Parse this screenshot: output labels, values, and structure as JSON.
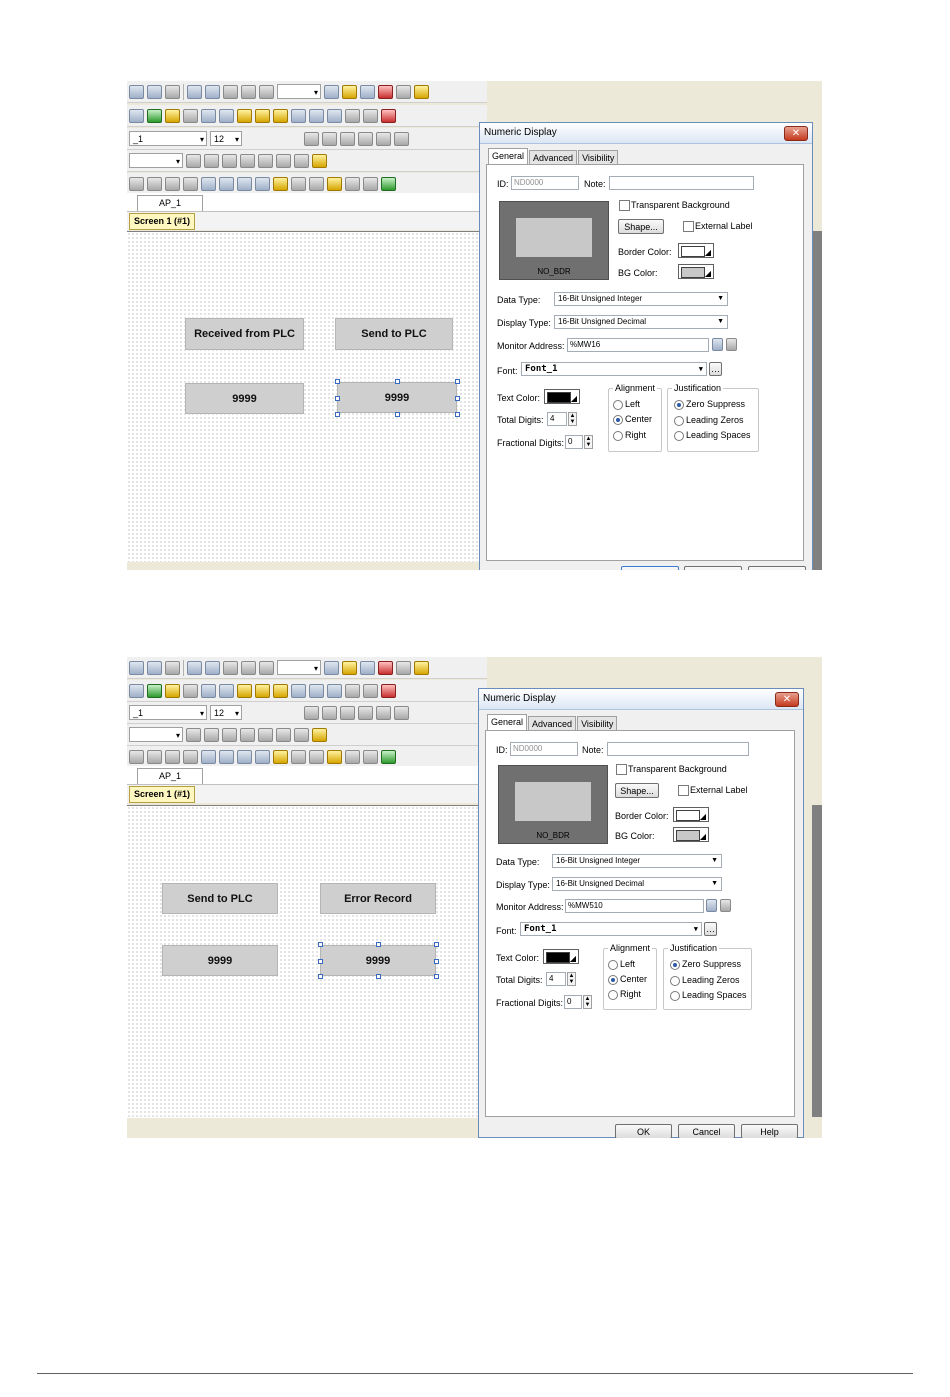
{
  "screens": [
    {
      "toolbar": {
        "font_name": "_1",
        "font_size": "12"
      },
      "ap_tab": "AP_1",
      "screen_tab": "Screen 1 (#1)",
      "canvas_items": {
        "label_left": "Received from PLC",
        "label_right": "Send to PLC",
        "value_left": "9999",
        "value_right": "9999"
      },
      "dialog": {
        "title": "Numeric Display",
        "close_glyph": "✕",
        "tabs": [
          "General",
          "Advanced",
          "Visibility"
        ],
        "id_label": "ID:",
        "id_value": "ND0000",
        "note_label": "Note:",
        "note_value": "",
        "transparent_bg": "Transparent Background",
        "shape_button": "Shape...",
        "external_label": "External Label",
        "border_color": "Border Color:",
        "bg_color": "BG Color:",
        "preview_caption": "NO_BDR",
        "data_type_label": "Data Type:",
        "data_type_value": "16-Bit Unsigned Integer",
        "display_type_label": "Display Type:",
        "display_type_value": "16-Bit Unsigned Decimal",
        "monitor_address_label": "Monitor Address:",
        "monitor_address_value": "%MW16",
        "font_label": "Font:",
        "font_value": "Font_1",
        "text_color_label": "Text Color:",
        "total_digits_label": "Total Digits:",
        "total_digits_value": "4",
        "fractional_digits_label": "Fractional Digits:",
        "fractional_digits_value": "0",
        "alignment_title": "Alignment",
        "alignment_options": [
          "Left",
          "Center",
          "Right"
        ],
        "alignment_selected": "Center",
        "justification_title": "Justification",
        "justification_options": [
          "Zero Suppress",
          "Leading Zeros",
          "Leading Spaces"
        ],
        "justification_selected": "Zero Suppress",
        "buttons": {
          "ok": "",
          "cancel": "",
          "help": ""
        }
      }
    },
    {
      "toolbar": {
        "font_name": "_1",
        "font_size": "12"
      },
      "ap_tab": "AP_1",
      "screen_tab": "Screen 1 (#1)",
      "canvas_items": {
        "label_left": "Send to PLC",
        "label_right": "Error Record",
        "value_left": "9999",
        "value_right": "9999"
      },
      "dialog": {
        "title": "Numeric Display",
        "close_glyph": "✕",
        "tabs": [
          "General",
          "Advanced",
          "Visibility"
        ],
        "id_label": "ID:",
        "id_value": "ND0000",
        "note_label": "Note:",
        "note_value": "",
        "transparent_bg": "Transparent Background",
        "shape_button": "Shape...",
        "external_label": "External Label",
        "border_color": "Border Color:",
        "bg_color": "BG Color:",
        "preview_caption": "NO_BDR",
        "data_type_label": "Data Type:",
        "data_type_value": "16-Bit Unsigned Integer",
        "display_type_label": "Display Type:",
        "display_type_value": "16-Bit Unsigned Decimal",
        "monitor_address_label": "Monitor Address:",
        "monitor_address_value": "%MW510",
        "font_label": "Font:",
        "font_value": "Font_1",
        "text_color_label": "Text Color:",
        "total_digits_label": "Total Digits:",
        "total_digits_value": "4",
        "fractional_digits_label": "Fractional Digits:",
        "fractional_digits_value": "0",
        "alignment_title": "Alignment",
        "alignment_options": [
          "Left",
          "Center",
          "Right"
        ],
        "alignment_selected": "Center",
        "justification_title": "Justification",
        "justification_options": [
          "Zero Suppress",
          "Leading Zeros",
          "Leading Spaces"
        ],
        "justification_selected": "Zero Suppress",
        "buttons": {
          "ok": "OK",
          "cancel": "Cancel",
          "help": "Help"
        }
      }
    }
  ],
  "colors": {
    "canvas_item_fill": "#cfcfcf",
    "dialog_bg": "#f0f0f0",
    "title_gradient": "#dbe6f4"
  },
  "icons": [
    "zoom-in-icon",
    "zoom-out-icon",
    "help-icon",
    "lightbulb-icon",
    "color-picker-icon"
  ]
}
